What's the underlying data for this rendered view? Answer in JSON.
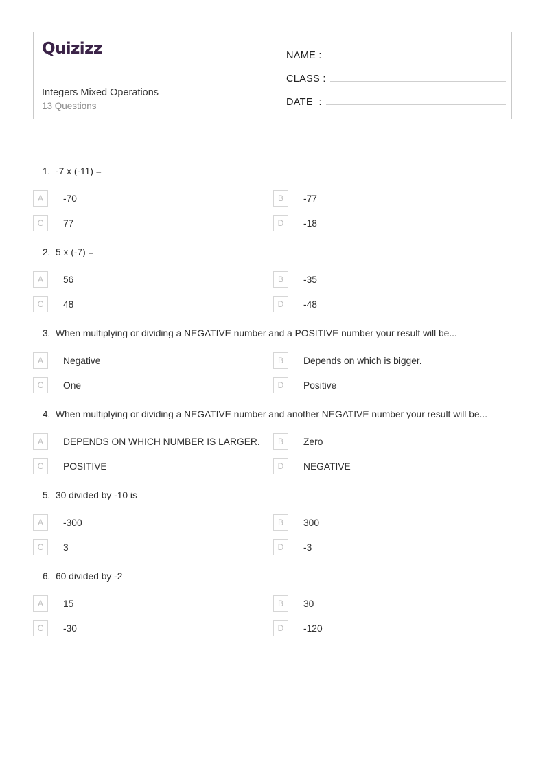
{
  "header": {
    "logo_text": "Quizizz",
    "title": "Integers Mixed Operations",
    "question_count_label": "13 Questions",
    "fields": [
      {
        "label": "NAME :",
        "value": ""
      },
      {
        "label": "CLASS :",
        "value": ""
      },
      {
        "label": "DATE  :",
        "value": ""
      }
    ]
  },
  "colors": {
    "brand": "#3b2348",
    "card_border": "#c9c9c9",
    "option_box_border": "#d6d6d6",
    "option_letter": "#bdbdbd",
    "title": "#3a3a3a",
    "subtitle": "#8c8c8c",
    "body_text": "#2f2f2f",
    "field_line": "#cfcfcf",
    "page_background": "#ffffff"
  },
  "option_letters": [
    "A",
    "B",
    "C",
    "D"
  ],
  "questions": [
    {
      "number": "1.",
      "text": "-7 x  (-11)  =",
      "options": [
        "-70",
        "-77",
        "77",
        "-18"
      ]
    },
    {
      "number": "2.",
      "text": "5 x (-7) =",
      "options": [
        "56",
        "-35",
        "48",
        "-48"
      ]
    },
    {
      "number": "3.",
      "text": "When multiplying or dividing a NEGATIVE number and a POSITIVE number your result will be...",
      "options": [
        "Negative",
        "Depends on which is bigger.",
        "One",
        "Positive"
      ]
    },
    {
      "number": "4.",
      "text": "When multiplying or dividing a NEGATIVE number and another NEGATIVE number your result will be...",
      "options": [
        "DEPENDS ON WHICH NUMBER IS LARGER.",
        "Zero",
        "POSITIVE",
        "NEGATIVE"
      ]
    },
    {
      "number": "5.",
      "text": "30 divided by -10 is",
      "options": [
        "-300",
        "300",
        "3",
        "-3"
      ]
    },
    {
      "number": "6.",
      "text": "60 divided by -2",
      "options": [
        "15",
        "30",
        "-30",
        "-120"
      ]
    }
  ]
}
